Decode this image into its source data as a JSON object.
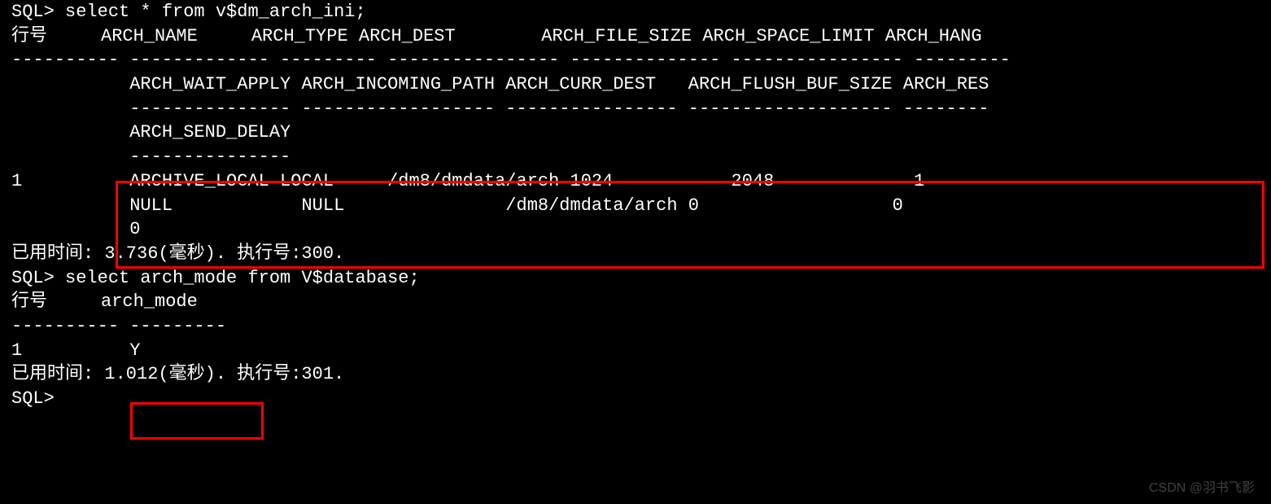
{
  "lines": {
    "l0": "SQL> select * from v$dm_arch_ini;",
    "l1": "",
    "l2": "行号     ARCH_NAME     ARCH_TYPE ARCH_DEST        ARCH_FILE_SIZE ARCH_SPACE_LIMIT ARCH_HANG",
    "l3": "---------- ------------- --------- ---------------- -------------- ---------------- ---------",
    "l4": "           ARCH_WAIT_APPLY ARCH_INCOMING_PATH ARCH_CURR_DEST   ARCH_FLUSH_BUF_SIZE ARCH_RES",
    "l5": "           --------------- ------------------ ---------------- ------------------- --------",
    "l6": "           ARCH_SEND_DELAY",
    "l7": "           ---------------",
    "l8": "1          ARCHIVE_LOCAL LOCAL     /dm8/dmdata/arch 1024           2048             1",
    "l9": "           NULL            NULL               /dm8/dmdata/arch 0                  0",
    "l10": "           0",
    "l11": "",
    "l12": "",
    "l13": "已用时间: 3.736(毫秒). 执行号:300.",
    "l14": "SQL> select arch_mode from V$database;",
    "l15": "",
    "l16": "行号     arch_mode",
    "l17": "---------- ---------",
    "l18": "1          Y",
    "l19": "",
    "l20": "已用时间: 1.012(毫秒). 执行号:301.",
    "l21": "SQL>"
  },
  "watermark": "CSDN @羽书飞影",
  "chart_data": {
    "type": "table",
    "queries": [
      {
        "sql": "select * from v$dm_arch_ini;",
        "elapsed_ms": 3.736,
        "exec_id": 300,
        "columns": [
          "行号",
          "ARCH_NAME",
          "ARCH_TYPE",
          "ARCH_DEST",
          "ARCH_FILE_SIZE",
          "ARCH_SPACE_LIMIT",
          "ARCH_HANG",
          "ARCH_WAIT_APPLY",
          "ARCH_INCOMING_PATH",
          "ARCH_CURR_DEST",
          "ARCH_FLUSH_BUF_SIZE",
          "ARCH_RES",
          "ARCH_SEND_DELAY"
        ],
        "rows": [
          {
            "行号": 1,
            "ARCH_NAME": "ARCHIVE_LOCAL",
            "ARCH_TYPE": "LOCAL",
            "ARCH_DEST": "/dm8/dmdata/arch",
            "ARCH_FILE_SIZE": 1024,
            "ARCH_SPACE_LIMIT": 2048,
            "ARCH_HANG": 1,
            "ARCH_WAIT_APPLY": "NULL",
            "ARCH_INCOMING_PATH": "NULL",
            "ARCH_CURR_DEST": "/dm8/dmdata/arch",
            "ARCH_FLUSH_BUF_SIZE": 0,
            "ARCH_RES": 0,
            "ARCH_SEND_DELAY": 0
          }
        ]
      },
      {
        "sql": "select arch_mode from V$database;",
        "elapsed_ms": 1.012,
        "exec_id": 301,
        "columns": [
          "行号",
          "arch_mode"
        ],
        "rows": [
          {
            "行号": 1,
            "arch_mode": "Y"
          }
        ]
      }
    ]
  }
}
